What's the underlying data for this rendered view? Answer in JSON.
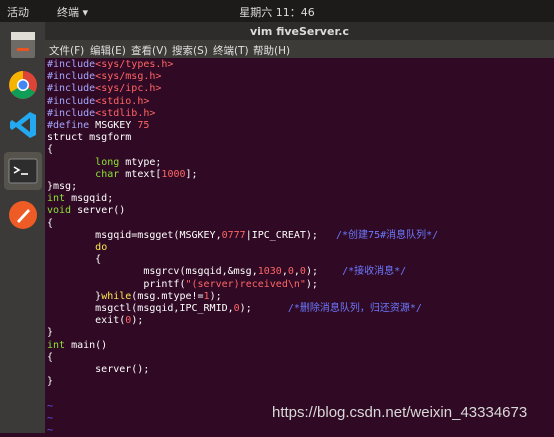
{
  "topbar": {
    "activities": "活动",
    "app_menu": "终端 ▾",
    "clock": "星期六 11：46"
  },
  "window": {
    "title": "vim fiveServer.c"
  },
  "menu": [
    "文件(F)",
    "编辑(E)",
    "查看(V)",
    "搜索(S)",
    "终端(T)",
    "帮助(H)"
  ],
  "dock": [
    "files-icon",
    "chrome-icon",
    "vscode-icon",
    "terminal-icon",
    "postman-icon"
  ],
  "code": [
    [
      [
        "pp",
        "#include"
      ],
      [
        "st",
        "<sys/types.h>"
      ]
    ],
    [
      [
        "pp",
        "#include"
      ],
      [
        "st",
        "<sys/msg.h>"
      ]
    ],
    [
      [
        "pp",
        "#include"
      ],
      [
        "st",
        "<sys/ipc.h>"
      ]
    ],
    [
      [
        "pp",
        "#include"
      ],
      [
        "st",
        "<stdio.h>"
      ]
    ],
    [
      [
        "pp",
        "#include"
      ],
      [
        "st",
        "<stdlib.h>"
      ]
    ],
    [
      [
        "pp",
        "#define"
      ],
      [
        "tx",
        " MSGKEY "
      ],
      [
        "nm",
        "75"
      ]
    ],
    [
      [
        "tx",
        "struct msgform"
      ]
    ],
    [
      [
        "tx",
        "{"
      ]
    ],
    [
      [
        "tx",
        "        "
      ],
      [
        "ty",
        "long"
      ],
      [
        "tx",
        " mtype;"
      ]
    ],
    [
      [
        "tx",
        "        "
      ],
      [
        "ty",
        "char"
      ],
      [
        "tx",
        " mtext["
      ],
      [
        "nm",
        "1000"
      ],
      [
        "tx",
        "];"
      ]
    ],
    [
      [
        "tx",
        "}msg;"
      ]
    ],
    [
      [
        "ty",
        "int"
      ],
      [
        "tx",
        " msgqid;"
      ]
    ],
    [
      [
        "ty",
        "void"
      ],
      [
        "tx",
        " server()"
      ]
    ],
    [
      [
        "tx",
        "{"
      ]
    ],
    [
      [
        "tx",
        "        msgqid=msgget(MSGKEY,"
      ],
      [
        "nm",
        "0777"
      ],
      [
        "tx",
        "|IPC_CREAT);   "
      ],
      [
        "cm",
        "/*创建75#消息队列*/"
      ]
    ],
    [
      [
        "tx",
        "        "
      ],
      [
        "kw",
        "do"
      ]
    ],
    [
      [
        "tx",
        "        {"
      ]
    ],
    [
      [
        "tx",
        "                msgrcv(msgqid,&msg,"
      ],
      [
        "nm",
        "1030"
      ],
      [
        "tx",
        ","
      ],
      [
        "nm",
        "0"
      ],
      [
        "tx",
        ","
      ],
      [
        "nm",
        "0"
      ],
      [
        "tx",
        ");    "
      ],
      [
        "cm",
        "/*接收消息*/"
      ]
    ],
    [
      [
        "tx",
        "                printf("
      ],
      [
        "st",
        "\"(server)received\\n\""
      ],
      [
        "tx",
        ");"
      ]
    ],
    [
      [
        "tx",
        "        }"
      ],
      [
        "kw",
        "while"
      ],
      [
        "tx",
        "(msg.mtype!="
      ],
      [
        "nm",
        "1"
      ],
      [
        "tx",
        ");"
      ]
    ],
    [
      [
        "tx",
        "        msgctl(msgqid,IPC_RMID,"
      ],
      [
        "nm",
        "0"
      ],
      [
        "tx",
        ");      "
      ],
      [
        "cm",
        "/*删除消息队列，归还资源*/"
      ]
    ],
    [
      [
        "tx",
        "        exit("
      ],
      [
        "nm",
        "0"
      ],
      [
        "tx",
        ");"
      ]
    ],
    [
      [
        "tx",
        "}"
      ]
    ],
    [
      [
        "ty",
        "int"
      ],
      [
        "tx",
        " main()"
      ]
    ],
    [
      [
        "tx",
        "{"
      ]
    ],
    [
      [
        "tx",
        "        server();"
      ]
    ],
    [
      [
        "tx",
        "}"
      ]
    ],
    [
      [
        "tx",
        ""
      ]
    ],
    [
      [
        "ti",
        "~"
      ]
    ],
    [
      [
        "ti",
        "~"
      ]
    ],
    [
      [
        "ti",
        "~"
      ]
    ]
  ],
  "watermark": "https://blog.csdn.net/weixin_43334673"
}
